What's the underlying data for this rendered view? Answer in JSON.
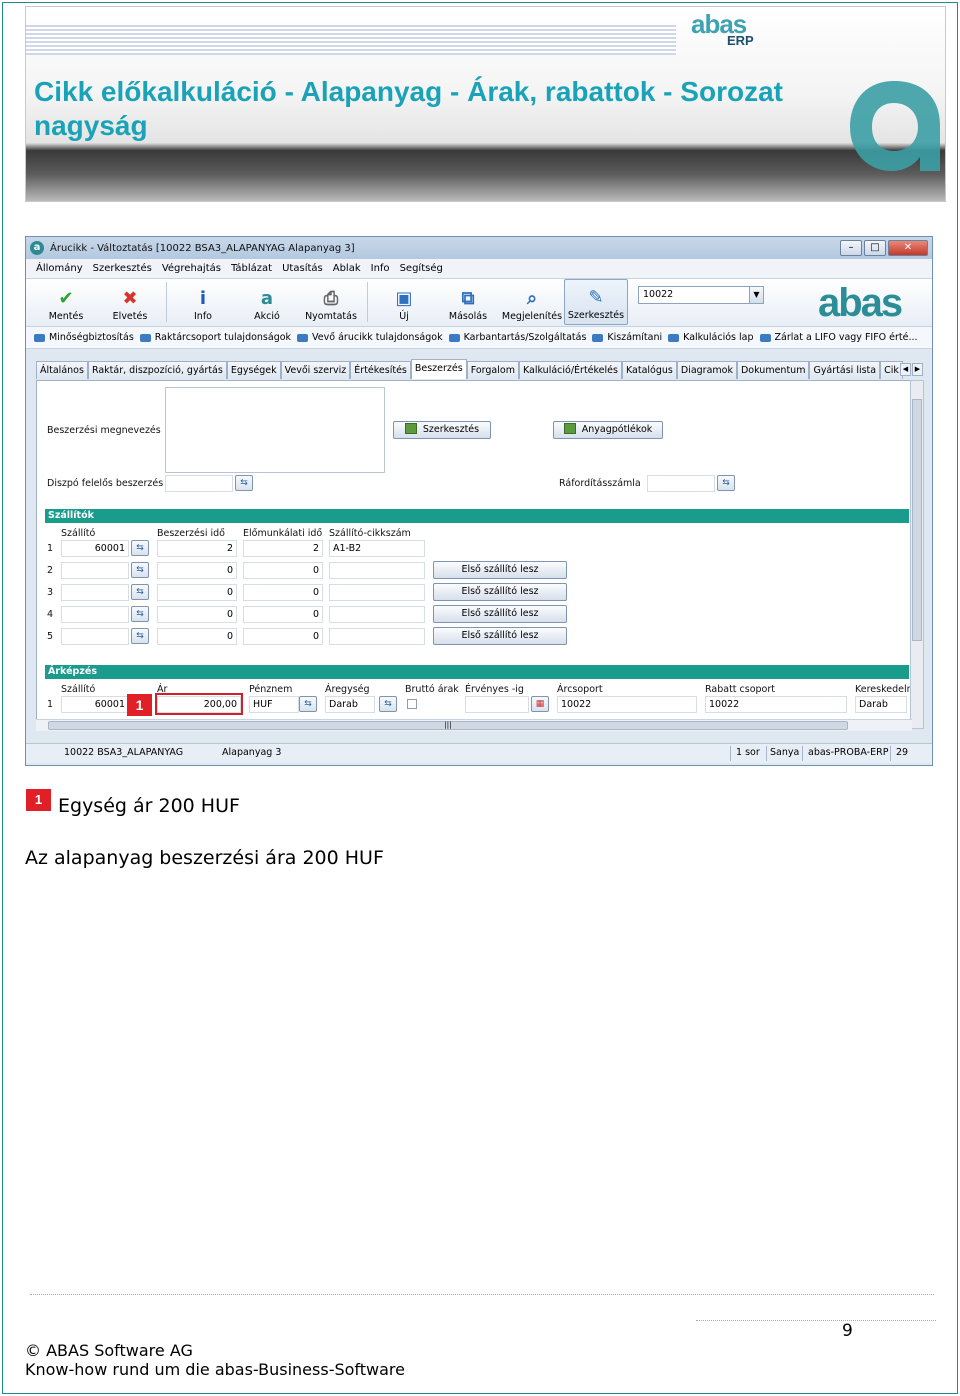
{
  "header": {
    "title_line1": "Cikk előkalkuláció - Alapanyag - Árak, rabattok - Sorozat",
    "title_line2": "nagyság",
    "logo_text": "abas",
    "logo_sub": "ERP"
  },
  "window": {
    "title": "Árucikk - Változtatás  [10022  BSA3_ALAPANYAG  Alapanyag 3]",
    "menu": [
      "Állomány",
      "Szerkesztés",
      "Végrehajtás",
      "Táblázat",
      "Utasítás",
      "Ablak",
      "Info",
      "Segítség"
    ],
    "toolbar": [
      {
        "label": "Mentés",
        "icon": "check-icon"
      },
      {
        "label": "Elvetés",
        "icon": "x-icon"
      },
      {
        "label": "Info",
        "icon": "info-icon"
      },
      {
        "label": "Akció",
        "icon": "abas-a-icon"
      },
      {
        "label": "Nyomtatás",
        "icon": "printer-icon"
      },
      {
        "label": "Új",
        "icon": "new-window-icon"
      },
      {
        "label": "Másolás",
        "icon": "copy-icon"
      },
      {
        "label": "Megjelenítés",
        "icon": "view-icon"
      },
      {
        "label": "Szerkesztés",
        "icon": "edit-icon"
      }
    ],
    "search_value": "10022",
    "brand": "abas",
    "links": [
      "Minőségbiztosítás",
      "Raktárcsoport tulajdonságok",
      "Vevő árucikk tulajdonságok",
      "Karbantartás/Szolgáltatás",
      "Kiszámítani",
      "Kalkulációs lap",
      "Zárlat a LIFO vagy FIFO érté..."
    ],
    "tabs": [
      "Általános",
      "Raktár, diszpozíció, gyártás",
      "Egységek",
      "Vevői szerviz",
      "Értékesítés",
      "Beszerzés",
      "Forgalom",
      "Kalkuláció/Értékelés",
      "Katalógus",
      "Diagramok",
      "Dokumentum",
      "Gyártási lista",
      "Cik"
    ],
    "active_tab": "Beszerzés",
    "form": {
      "beszerzesi_megnevezes_label": "Beszerzési megnevezés",
      "szerkesztes_btn": "Szerkesztés",
      "anyagpotlekok_btn": "Anyagpótlékok",
      "diszpo_label": "Diszpó felelős beszerzés",
      "raforditas_label": "Ráfordításszámla"
    },
    "suppliers": {
      "title": "Szállítók",
      "headers": [
        "Szállító",
        "Beszerzési idő",
        "Előmunkálati idő",
        "Szállító-cikkszám"
      ],
      "rows": [
        {
          "n": "1",
          "supplier": "60001",
          "lead": "2",
          "prep": "2",
          "item": "A1-B2",
          "btn": ""
        },
        {
          "n": "2",
          "supplier": "",
          "lead": "0",
          "prep": "0",
          "item": "",
          "btn": "Első szállító lesz"
        },
        {
          "n": "3",
          "supplier": "",
          "lead": "0",
          "prep": "0",
          "item": "",
          "btn": "Első szállító lesz"
        },
        {
          "n": "4",
          "supplier": "",
          "lead": "0",
          "prep": "0",
          "item": "",
          "btn": "Első szállító lesz"
        },
        {
          "n": "5",
          "supplier": "",
          "lead": "0",
          "prep": "0",
          "item": "",
          "btn": "Első szállító lesz"
        }
      ]
    },
    "pricing": {
      "title": "Árképzés",
      "headers": [
        "Szállító",
        "Ár",
        "Pénznem",
        "Áregység",
        "Bruttó árak",
        "Érvényes -ig",
        "Árcsoport",
        "Rabatt csoport",
        "Kereskedelmi eg"
      ],
      "row": {
        "n": "1",
        "supplier": "60001",
        "price": "200,00",
        "currency": "HUF",
        "unit": "Darab",
        "valid": "",
        "group": "10022",
        "discount": "10022",
        "trade": "Darab"
      }
    },
    "marker": "1",
    "status": [
      "10022 BSA3_ALAPANYAG",
      "Alapanyag 3",
      "1 sor",
      "Sanya",
      "abas-PROBA-ERP",
      "29"
    ]
  },
  "captions": {
    "marker": "1",
    "line1": "Egység ár 200 HUF",
    "line2": "Az alapanyag beszerzési ára 200 HUF"
  },
  "footer": {
    "page": "9",
    "copyright": "© ABAS Software AG",
    "tagline": "Know-how rund um die abas-Business-Software"
  }
}
